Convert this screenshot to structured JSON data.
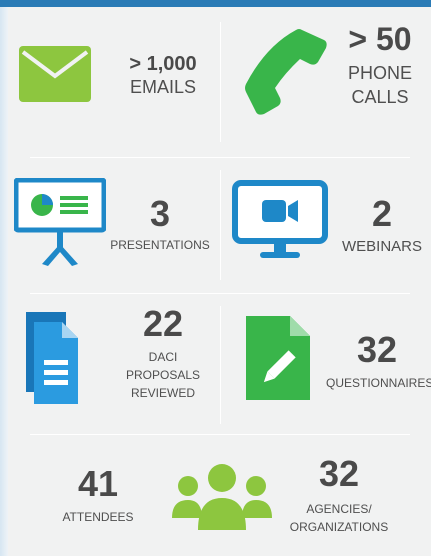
{
  "stats": {
    "emails": {
      "value": "> 1,000",
      "label": "EMAILS",
      "icon": "envelope-icon"
    },
    "phone_calls": {
      "value": "> 50",
      "label_line1": "PHONE",
      "label_line2": "CALLS",
      "icon": "phone-icon"
    },
    "presentations": {
      "value": "3",
      "label": "PRESENTATIONS",
      "icon": "presentation-board-icon"
    },
    "webinars": {
      "value": "2",
      "label": "WEBINARS",
      "icon": "monitor-video-icon"
    },
    "daci_proposals": {
      "value": "22",
      "label_line1": "DACI",
      "label_line2": "PROPOSALS",
      "label_line3": "REVIEWED",
      "icon": "document-icon"
    },
    "questionnaires": {
      "value": "32",
      "label": "QUESTIONNAIRES",
      "icon": "edit-document-icon"
    },
    "attendees": {
      "value": "41",
      "label": "ATTENDEES",
      "icon": "people-group-icon"
    },
    "agencies": {
      "value": "32",
      "label_line1": "AGENCIES/",
      "label_line2": "ORGANIZATIONS"
    }
  },
  "colors": {
    "green": "#8dc63f",
    "dark_green": "#39b54a",
    "blue": "#1e88c8",
    "topbar": "#2a7bb6"
  }
}
